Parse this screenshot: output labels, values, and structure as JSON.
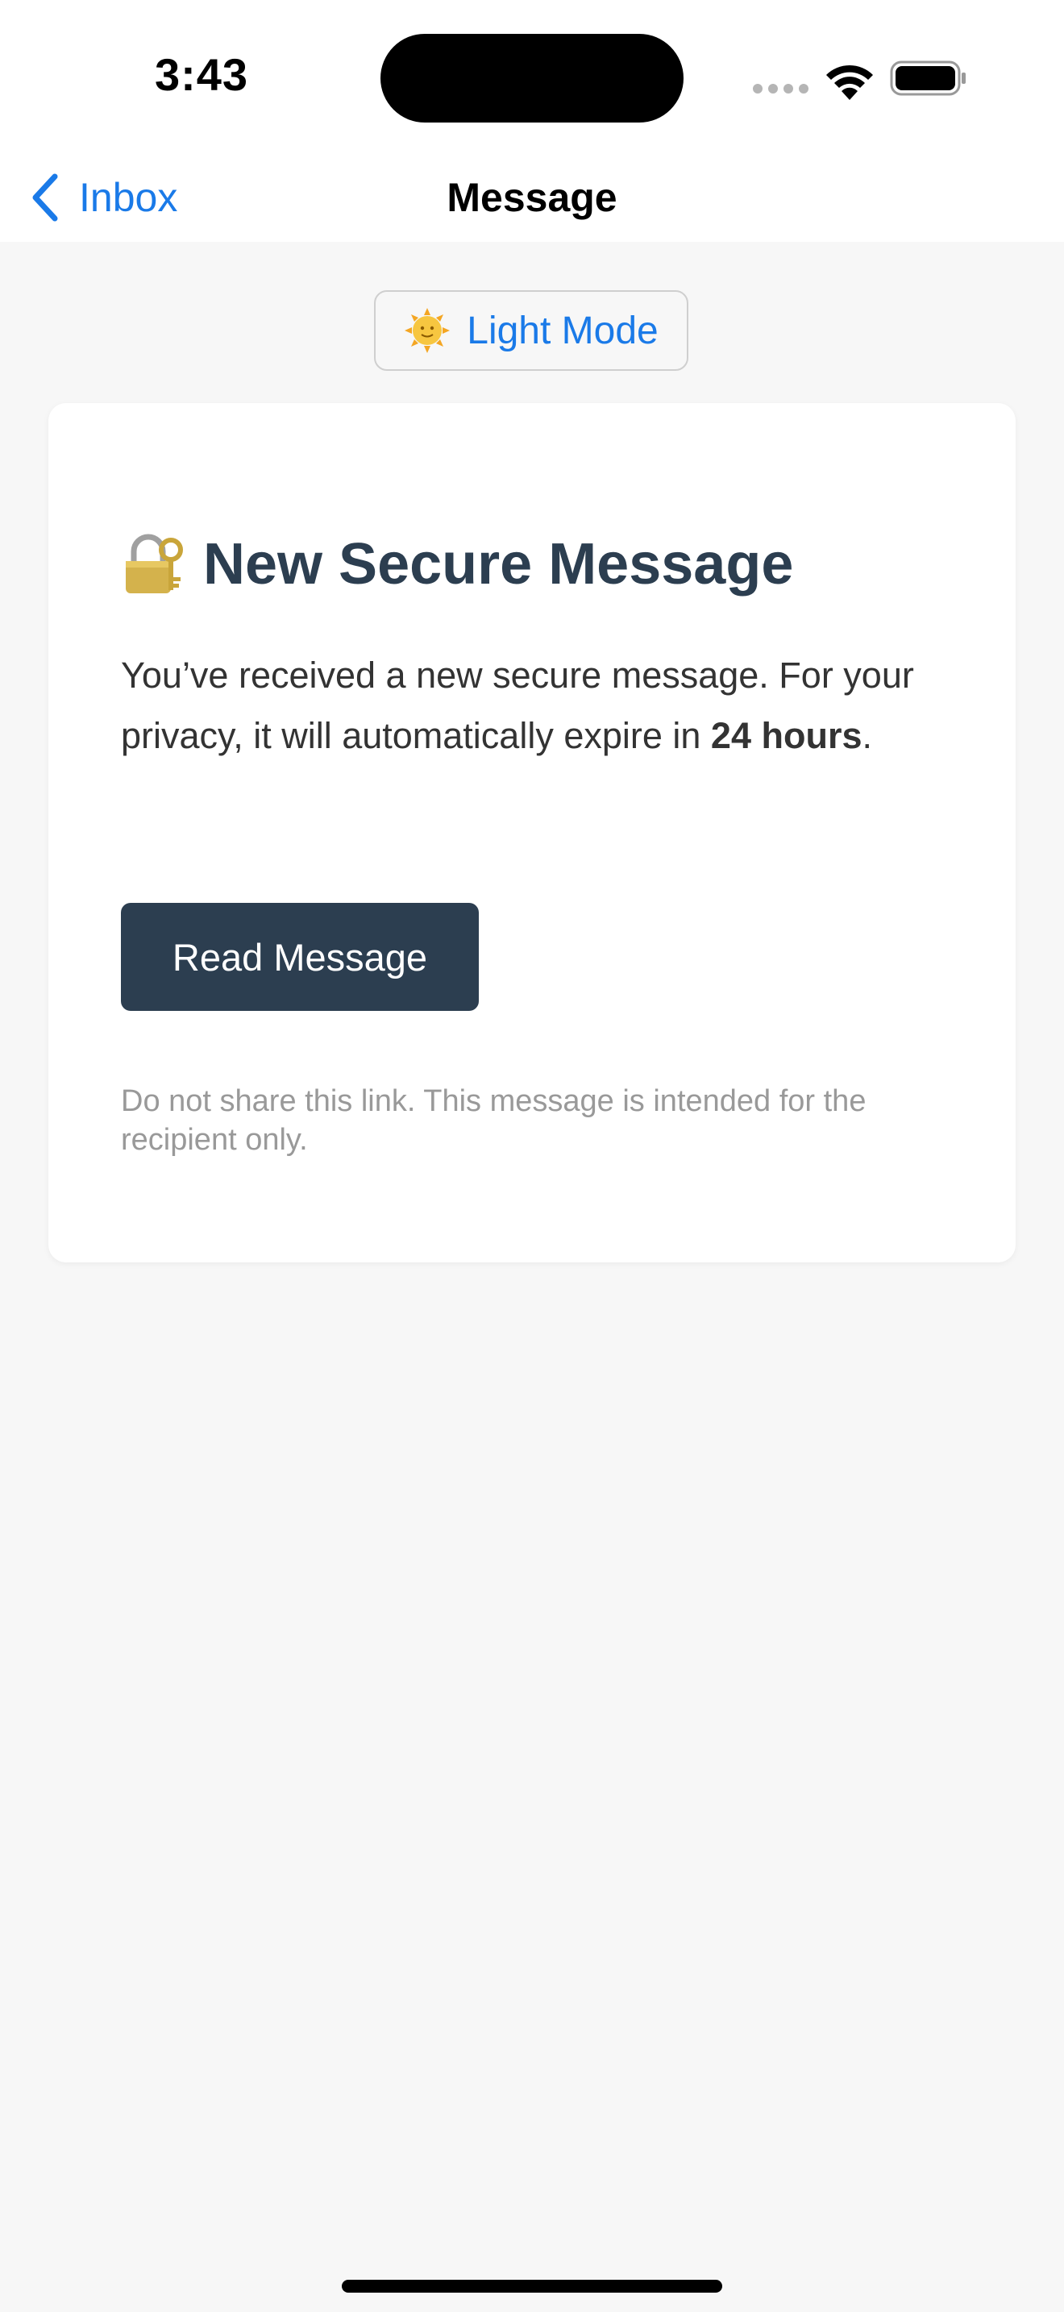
{
  "status_bar": {
    "time": "3:43"
  },
  "nav": {
    "back_label": "Inbox",
    "title": "Message"
  },
  "theme_toggle": {
    "label": "Light Mode",
    "icon": "sun-icon"
  },
  "card": {
    "icon": "locked-with-key-icon",
    "title": "New Secure Message",
    "body_before": "You’ve received a new secure message. For your privacy, it will automatically expire in ",
    "body_bold": "24 hours",
    "body_after": ".",
    "button_label": "Read Message",
    "footer": "Do not share this link. This message is intended for the recipient only."
  },
  "colors": {
    "accent": "#1a7ae8",
    "heading": "#2c3e50",
    "button_bg": "#2c3e50",
    "background": "#f7f7f7"
  }
}
